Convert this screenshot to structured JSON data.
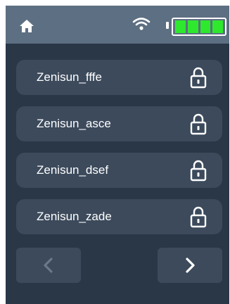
{
  "networks": [
    {
      "ssid": "Zenisun_fffe",
      "icon": "lock-icon"
    },
    {
      "ssid": "Zenisun_asce",
      "icon": "lock-icon"
    },
    {
      "ssid": "Zenisun_dsef",
      "icon": "lock-icon"
    },
    {
      "ssid": "Zenisun_zade",
      "icon": "lock-icon"
    }
  ],
  "status_bar": {
    "home_icon": "home-icon",
    "wifi_icon": "wifi-icon",
    "battery_level": 1.0,
    "battery_bars": 4
  },
  "navigation": {
    "prev_icon": "chevron-left-icon",
    "next_icon": "chevron-right-icon",
    "prev_enabled": false,
    "next_enabled": true
  },
  "colors": {
    "background": "#2a3747",
    "status_bar": "#5d6f82",
    "item": "#3c4a5c",
    "battery_fill": "#2ee82e",
    "text": "#ffffff",
    "disabled_icon": "#6b7889"
  }
}
